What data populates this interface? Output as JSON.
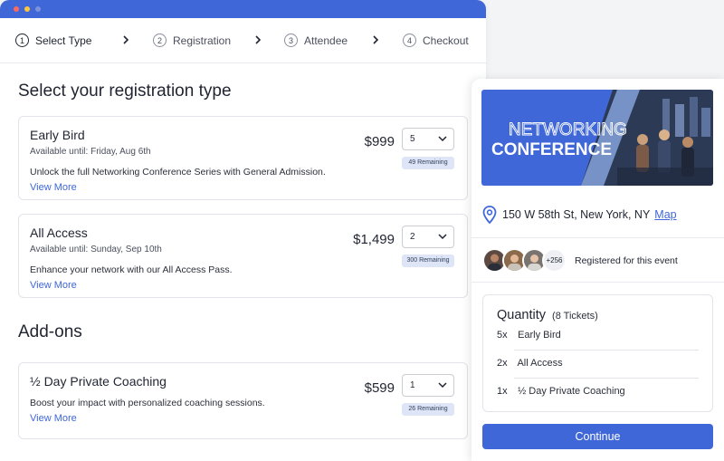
{
  "steps": [
    {
      "num": "1",
      "label": "Select Type"
    },
    {
      "num": "2",
      "label": "Registration"
    },
    {
      "num": "3",
      "label": "Attendee"
    },
    {
      "num": "4",
      "label": "Checkout"
    }
  ],
  "main": {
    "heading": "Select your registration type",
    "tickets": [
      {
        "name": "Early Bird",
        "available": "Available until: Friday, Aug 6th",
        "description": "Unlock the full Networking Conference Series with General Admission.",
        "more": "View More",
        "price": "$999",
        "qty": "5",
        "remaining": "49 Remaining"
      },
      {
        "name": "All Access",
        "available": "Available until: Sunday, Sep 10th",
        "description": "Enhance your network with our All Access Pass.",
        "more": "View More",
        "price": "$1,499",
        "qty": "2",
        "remaining": "300 Remaining"
      }
    ],
    "addons_heading": "Add-ons",
    "addons": [
      {
        "name": "½ Day Private Coaching",
        "description": "Boost your impact with personalized coaching sessions.",
        "more": "View More",
        "price": "$599",
        "qty": "1",
        "remaining": "26 Remaining"
      }
    ]
  },
  "summary": {
    "banner": {
      "line1": "NETWORKING",
      "line2": "CONFERENCE"
    },
    "address": "150 W 58th St, New York, NY",
    "map_link": "Map",
    "attendee_extra": "+256",
    "registered_text": "Registered for this event",
    "quantity_title": "Quantity",
    "quantity_count": "(8 Tickets)",
    "items": [
      {
        "qty": "5x",
        "name": "Early Bird"
      },
      {
        "qty": "2x",
        "name": "All Access"
      },
      {
        "qty": "1x",
        "name": "½ Day Private Coaching"
      }
    ],
    "continue_label": "Continue"
  },
  "colors": {
    "accent": "#3f67d8",
    "badge": "#dde5f7"
  }
}
